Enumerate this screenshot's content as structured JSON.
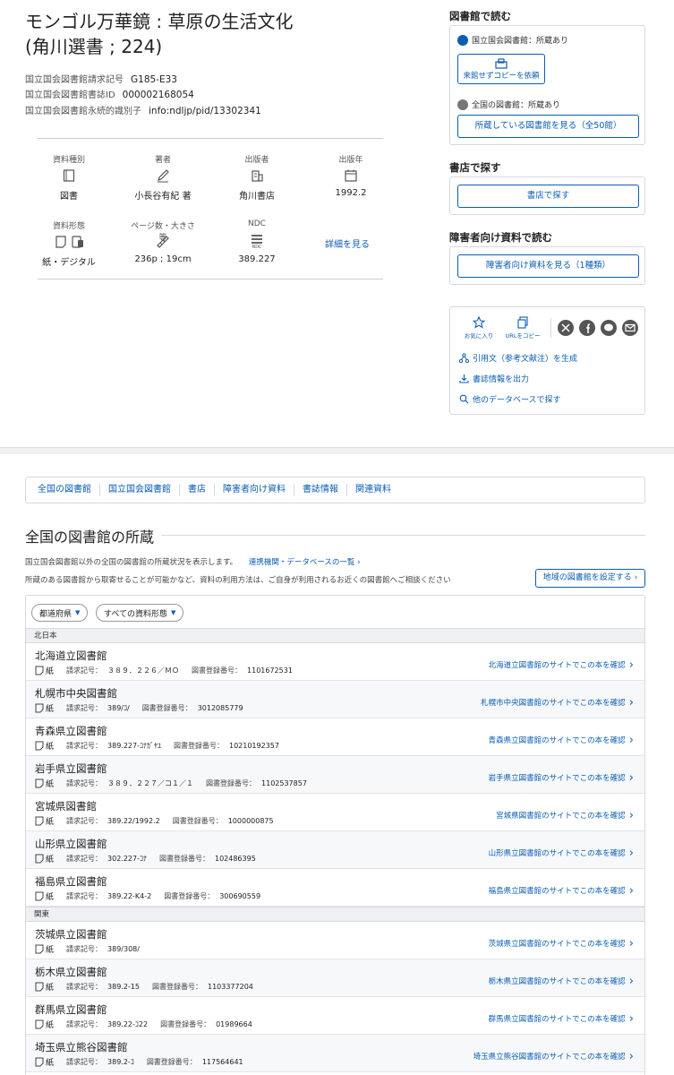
{
  "title": {
    "line1": "モンゴル万華鏡 : 草原の生活文化",
    "line2": "(角川選書 ; 224)"
  },
  "meta": [
    {
      "label": "国立国会図書館請求記号",
      "value": "G185-E33"
    },
    {
      "label": "国立国会図書館書誌ID",
      "value": "000002168054"
    },
    {
      "label": "国立国会図書館永続的識別子",
      "value": "info:ndljp/pid/13302341"
    }
  ],
  "biblio": {
    "type_label": "資料種別",
    "type_value": "図書",
    "author_label": "著者",
    "author_value": "小長谷有紀 著",
    "publisher_label": "出版者",
    "publisher_value": "角川書店",
    "year_label": "出版年",
    "year_value": "1992.2",
    "form_label": "資料形態",
    "form_value": "紙・デジタル",
    "pages_label": "ページ数・大きさ等",
    "pages_value": "236p ; 19cm",
    "ndc_label": "NDC",
    "ndc_value": "389.227",
    "ndc_icon_text": "NDC",
    "detail_link": "詳細を見る"
  },
  "sidebar": {
    "read_heading": "図書館で読む",
    "ndl_status": "国立国会図書館：所蔵あり",
    "copy_button": "来館せずコピーを依頼",
    "all_status": "全国の図書館：所蔵あり",
    "all_button": "所蔵している図書館を見る（全50館）",
    "store_heading": "書店で探す",
    "store_button": "書店で探す",
    "disability_heading": "障害者向け資料で読む",
    "disability_button": "障害者向け資料を見る（1種類）",
    "fav_label": "お気に入り",
    "url_label": "URLをコピー",
    "cite_link": "引用文（参考文献注）を生成",
    "export_link": "書誌情報を出力",
    "other_db_link": "他のデータベースで探す"
  },
  "tabs": [
    "全国の図書館",
    "国立国会図書館",
    "書店",
    "障害者向け資料",
    "書誌情報",
    "関連資料"
  ],
  "holdings": {
    "heading": "全国の図書館の所蔵",
    "intro1": "国立国会図書館以外の全国の図書館の所蔵状況を表示します。",
    "intro1_link": "連携機関・データベースの一覧",
    "intro2": "所蔵のある図書館から取寄せることが可能かなど、資料の利用方法は、ご自身が利用されるお近くの図書館へご相談ください",
    "region_button": "地域の図書館を設定する",
    "filter_pref": "都道府県",
    "filter_type": "すべての資料形態",
    "call_label": "請求記号：",
    "reg_label": "図書登録番号：",
    "paper": "紙",
    "regions": [
      {
        "name": "北日本",
        "libraries": [
          {
            "name": "北海道立図書館",
            "call": "３８９．２２６／ＭＯ",
            "reg": "1101672531",
            "link": "北海道立図書館のサイトでこの本を確認"
          },
          {
            "name": "札幌市中央図書館",
            "call": "389/ｺ/",
            "reg": "3012085779",
            "link": "札幌市中央図書館のサイトでこの本を確認"
          },
          {
            "name": "青森県立図書館",
            "call": "389.227-ｺﾅｶﾞﾔﾕ",
            "reg": "10210192357",
            "link": "青森県立図書館のサイトでこの本を確認"
          },
          {
            "name": "岩手県立図書館",
            "call": "３８９．２２７／コ１／１",
            "reg": "1102537857",
            "link": "岩手県立図書館のサイトでこの本を確認"
          },
          {
            "name": "宮城県図書館",
            "call": "389.22/1992.2",
            "reg": "1000000875",
            "link": "宮城県図書館のサイトでこの本を確認"
          },
          {
            "name": "山形県立図書館",
            "call": "302.227-ｺﾅ",
            "reg": "102486395",
            "link": "山形県立図書館のサイトでこの本を確認"
          },
          {
            "name": "福島県立図書館",
            "call": "389.22-K4-2",
            "reg": "300690559",
            "link": "福島県立図書館のサイトでこの本を確認"
          }
        ]
      },
      {
        "name": "関東",
        "libraries": [
          {
            "name": "茨城県立図書館",
            "call": "389/308/",
            "reg": "",
            "link": "茨城県立図書館のサイトでこの本を確認"
          },
          {
            "name": "栃木県立図書館",
            "call": "389.2-15",
            "reg": "1103377204",
            "link": "栃木県立図書館のサイトでこの本を確認"
          },
          {
            "name": "群馬県立図書館",
            "call": "389.22-ｺ22",
            "reg": "01989664",
            "link": "群馬県立図書館のサイトでこの本を確認"
          },
          {
            "name": "埼玉県立熊谷図書館",
            "call": "389.2-ｺ",
            "reg": "117564641",
            "link": "埼玉県立熊谷図書館のサイトでこの本を確認"
          }
        ]
      }
    ]
  }
}
